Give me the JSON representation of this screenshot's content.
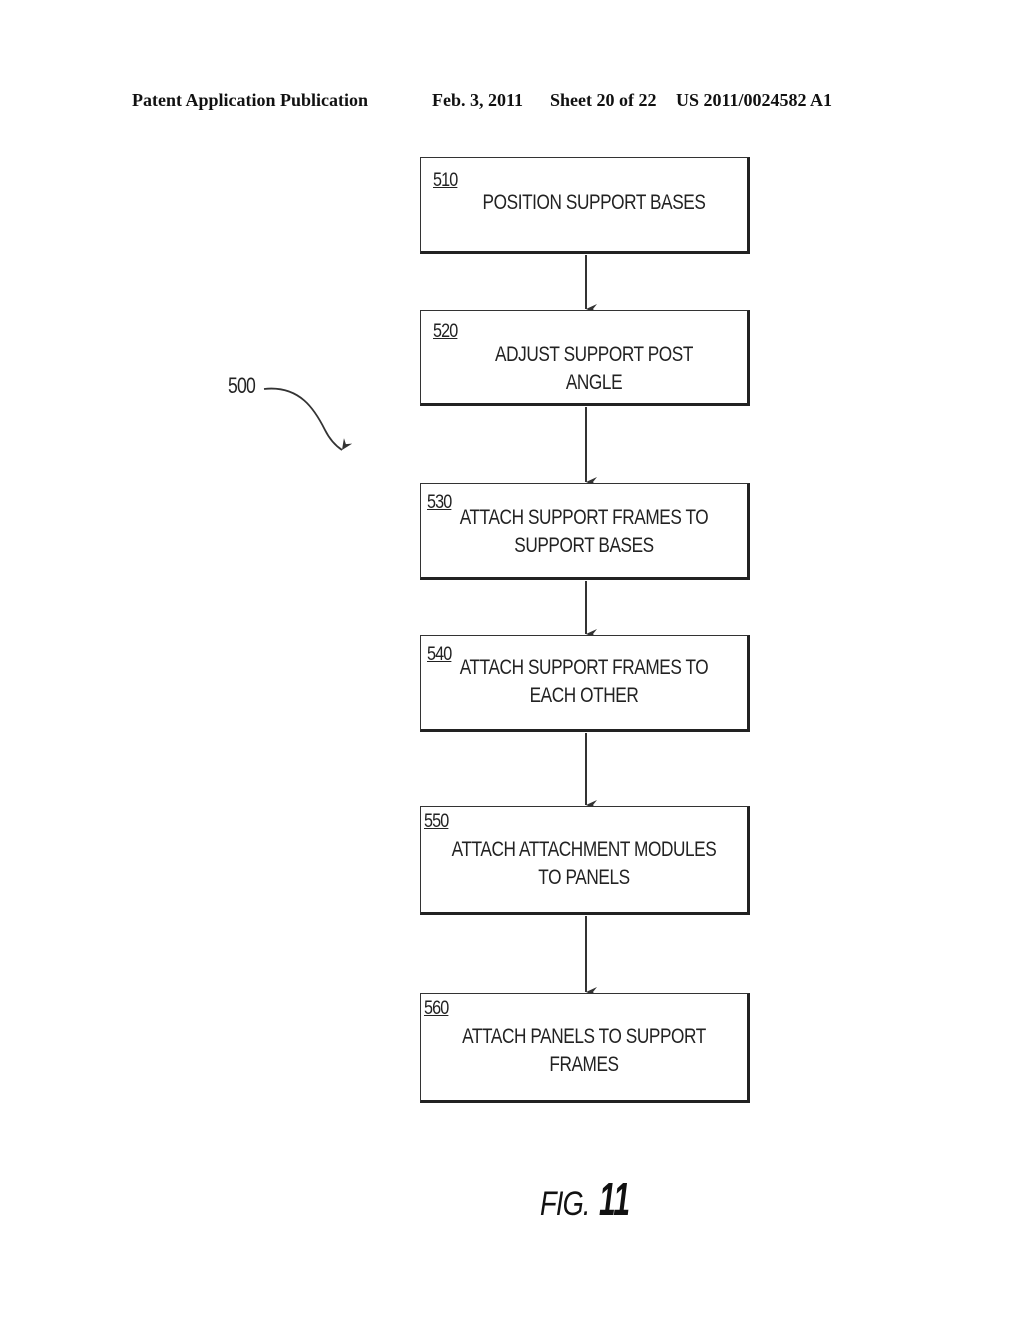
{
  "header": {
    "publication": "Patent Application Publication",
    "date": "Feb. 3, 2011",
    "sheet": "Sheet 20 of 22",
    "number": "US 2011/0024582 A1"
  },
  "flowchart": {
    "reference": "500",
    "steps": [
      {
        "ref": "510",
        "text": "POSITION SUPPORT BASES"
      },
      {
        "ref": "520",
        "text": "ADJUST SUPPORT POST ANGLE"
      },
      {
        "ref": "530",
        "line1": "ATTACH SUPPORT FRAMES TO",
        "line2": "SUPPORT BASES"
      },
      {
        "ref": "540",
        "line1": "ATTACH SUPPORT FRAMES TO",
        "line2": "EACH OTHER"
      },
      {
        "ref": "550",
        "line1": "ATTACH ATTACHMENT MODULES",
        "line2": "TO PANELS"
      },
      {
        "ref": "560",
        "line1": "ATTACH PANELS TO SUPPORT",
        "line2": "FRAMES"
      }
    ]
  },
  "figure": {
    "prefix": "FIG.",
    "number": "11"
  }
}
